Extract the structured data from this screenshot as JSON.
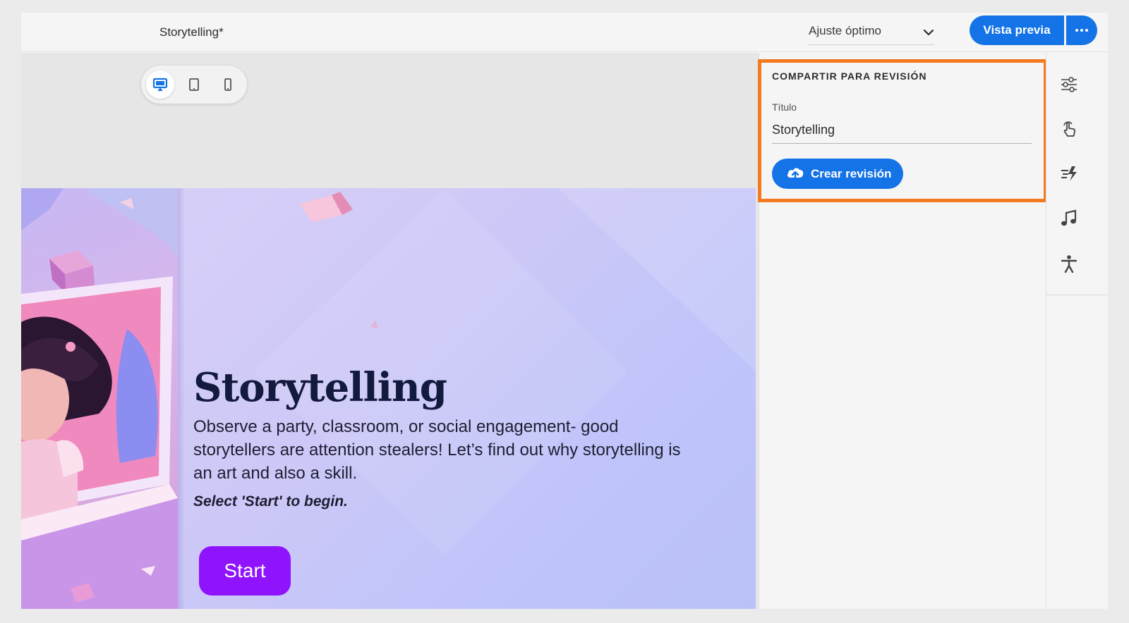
{
  "topbar": {
    "doc_title": "Storytelling*",
    "zoom_value": "Ajuste óptimo",
    "preview_label": "Vista previa",
    "more_icon": "more-icon"
  },
  "device_switcher": [
    {
      "icon": "desktop-icon",
      "active": true
    },
    {
      "icon": "tablet-icon",
      "active": false
    },
    {
      "icon": "phone-icon",
      "active": false
    }
  ],
  "slide": {
    "title": "Storytelling",
    "body": "Observe a party, classroom, or social engagement- good storytellers are attention stealers! Let’s find out why storytelling is an art and also a skill.",
    "cta": "Select 'Start' to begin.",
    "start_label": "Start"
  },
  "share_panel": {
    "heading": "COMPARTIR PARA REVISIÓN",
    "field_label": "Título",
    "title_value": "Storytelling",
    "create_label": "Crear revisión",
    "highlight_color": "#f47a20"
  },
  "rail_icons": [
    "properties-icon",
    "interactions-icon",
    "timing-icon",
    "audio-icon",
    "accessibility-icon"
  ],
  "colors": {
    "accent": "#1473e6",
    "start_button": "#9013fe"
  }
}
